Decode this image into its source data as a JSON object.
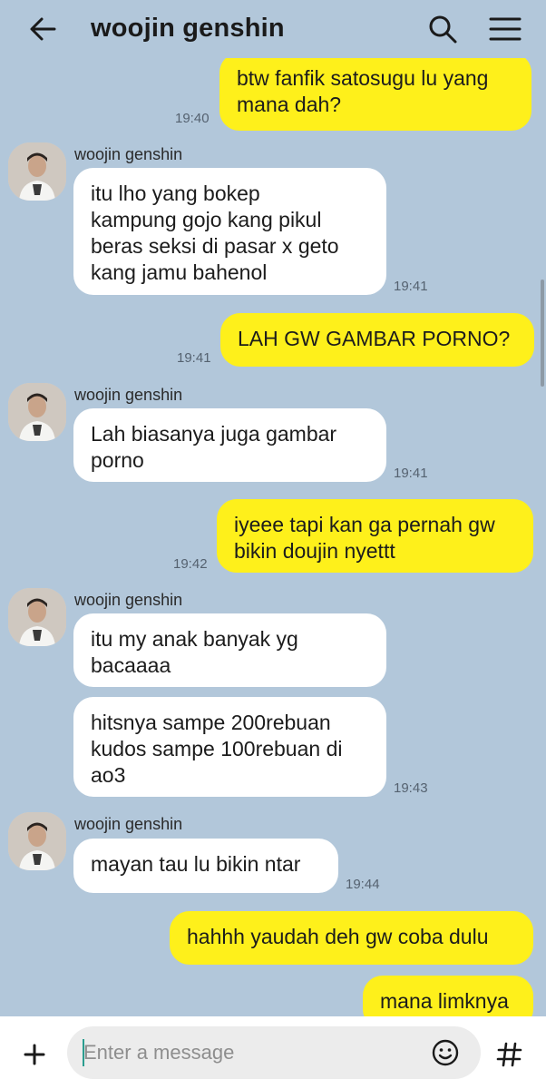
{
  "header": {
    "title": "woojin genshin",
    "icons": [
      "back-arrow-icon",
      "search-icon",
      "menu-icon"
    ]
  },
  "messages": [
    {
      "from": "me",
      "text": "btw fanfik satosugu lu yang\nmana dah?",
      "time": "19:40"
    },
    {
      "from": "them",
      "sender": "woojin genshin",
      "text": "itu lho yang bokep\nkampung gojo kang pikul\nberas seksi di pasar x geto\nkang jamu bahenol",
      "time": "19:41"
    },
    {
      "from": "me",
      "text": "LAH GW GAMBAR PORNO?",
      "time": "19:41"
    },
    {
      "from": "them",
      "sender": "woojin genshin",
      "text": "Lah biasanya juga gambar\nporno",
      "time": "19:41"
    },
    {
      "from": "me",
      "text": "iyeee tapi kan ga pernah gw\nbikin doujin nyettt",
      "time": "19:42"
    },
    {
      "from": "them",
      "sender": "woojin genshin",
      "text": "itu my anak banyak yg\nbacaaaa",
      "time": ""
    },
    {
      "from": "them",
      "text": "hitsnya sampe 200rebuan\nkudos sampe 100rebuan di\nao3",
      "time": "19:43"
    },
    {
      "from": "them",
      "sender": "woojin genshin",
      "text": "mayan tau lu bikin ntar",
      "time": "19:44"
    },
    {
      "from": "me",
      "text": "hahhh yaudah deh gw coba dulu",
      "time": ""
    },
    {
      "from": "me",
      "text": "mana limknya",
      "time": ""
    }
  ],
  "composer": {
    "placeholder": "Enter a message",
    "icons": [
      "plus-icon",
      "emoji-icon",
      "hashtag-icon"
    ]
  },
  "colors": {
    "background": "#b2c7da",
    "my_bubble": "#fef01b",
    "their_bubble": "#ffffff"
  }
}
